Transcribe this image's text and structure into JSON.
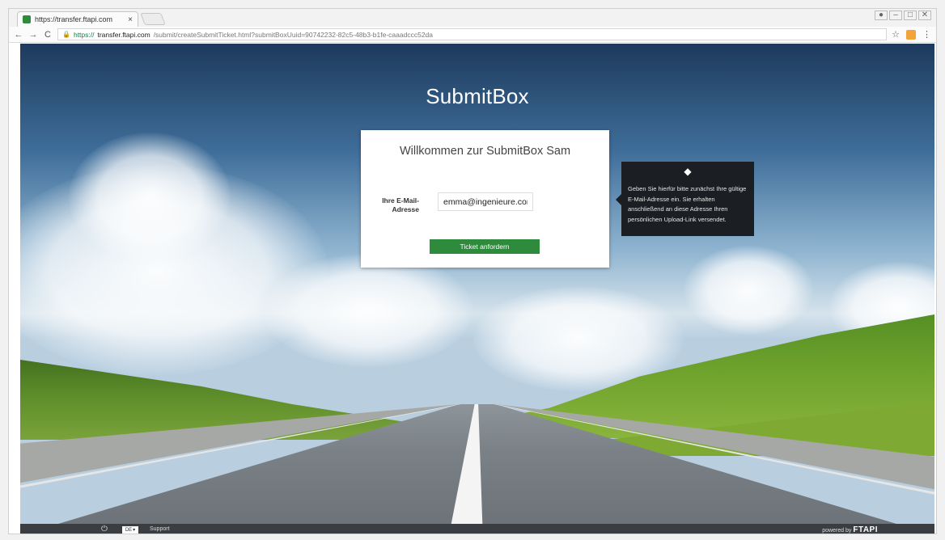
{
  "browser": {
    "tab_title": "https://transfer.ftapi.com",
    "tab_close": "×",
    "window_controls": [
      "user-icon",
      "minimize-icon",
      "maximize-icon",
      "close-icon"
    ],
    "back": "←",
    "forward": "→",
    "reload": "C",
    "url_scheme": "https://",
    "url_host": "transfer.ftapi.com",
    "url_path": "/submit/createSubmitTicket.html?submitBoxUuid=90742232-82c5-48b3-b1fe-caaadccc52da",
    "star": "☆",
    "menu": "⋮"
  },
  "page": {
    "brand": "SubmitBox",
    "card_title": "Willkommen zur SubmitBox Sam",
    "email_label_line1": "Ihre E-Mail-",
    "email_label_line2": "Adresse",
    "email_value": "emma@ingenieure.com",
    "submit_label": "Ticket anfordern",
    "tooltip_text": "Geben Sie hierfür bitte zunächst Ihre gültige E-Mail-Adresse ein. Sie erhalten anschließend an diese Adresse Ihren persönlichen Upload-Link versendet."
  },
  "footer": {
    "power_icon": "⏻",
    "language": "DE",
    "language_caret": "▾",
    "support": "Support",
    "powered_by": "powered by",
    "brand": "FTAPI"
  },
  "colors": {
    "accent": "#2e8b3c",
    "tooltip_bg": "#1b1e22",
    "footer_bg": "#3a3d41"
  }
}
